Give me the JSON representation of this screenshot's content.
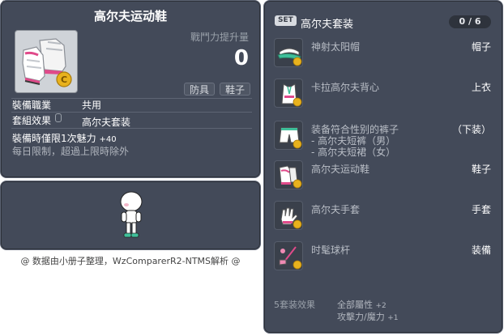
{
  "item_id": "01072823",
  "item": {
    "name": "高尔夫运动鞋",
    "power_label": "戰鬥力提升量",
    "power_value": "0",
    "tags": [
      "防具",
      "鞋子"
    ],
    "job_label": "裝備職業",
    "job_value": "共用",
    "set_label": "套組效果",
    "set_value": "高尔夫套装",
    "limit_text": "裝備時僅限1次魅力",
    "limit_bonus": "+40",
    "limit_note": "每日限制，超過上限時除外"
  },
  "credit": "@ 数据由小册子整理，WzComparerR2-NTMS解析 @",
  "set": {
    "badge": "SET",
    "title": "高尔夫套装",
    "count": "0 / 6",
    "items": [
      {
        "name": "神射太阳帽",
        "slot": "帽子",
        "icon": "visor-hat-icon"
      },
      {
        "name": "卡拉高尔夫背心",
        "slot": "上衣",
        "icon": "vest-icon"
      },
      {
        "name": "装备符合性别的裤子",
        "slot": "（下装）",
        "icon": "shorts-icon",
        "sub": [
          "- 高尔夫短裤（男）",
          "- 高尔夫短裙（女）"
        ]
      },
      {
        "name": "高尔夫运动鞋",
        "slot": "鞋子",
        "icon": "golf-shoes-icon"
      },
      {
        "name": "高尔夫手套",
        "slot": "手套",
        "icon": "golf-glove-icon"
      },
      {
        "name": "时髦球杆",
        "slot": "装備",
        "icon": "golf-club-icon"
      }
    ],
    "effect_label": "5套装效果",
    "effects": [
      {
        "text": "全部屬性",
        "bonus": "+2"
      },
      {
        "text": "攻擊力/魔力",
        "bonus": "+1"
      }
    ]
  },
  "colors": {
    "panel": "#434a59",
    "panel_border": "#5c6373",
    "accent_pink": "#e04a8a",
    "coin": "#e8b21d"
  }
}
